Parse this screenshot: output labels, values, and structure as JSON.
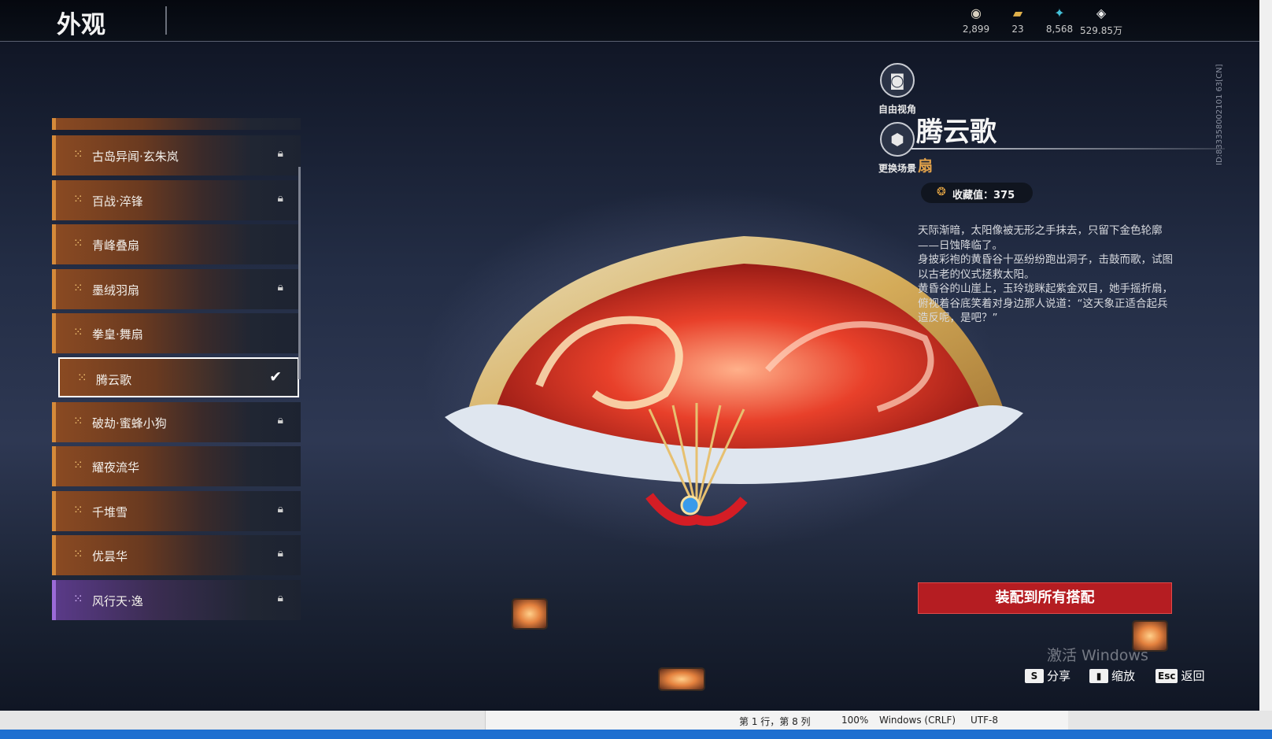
{
  "header": {
    "title": "外观"
  },
  "currencies": [
    {
      "icon": "coin-stack-icon",
      "glyph": "◉",
      "value": "2,899"
    },
    {
      "icon": "ticket-icon",
      "glyph": "▰",
      "value": "23"
    },
    {
      "icon": "feather-icon",
      "glyph": "✦",
      "value": "8,568"
    },
    {
      "icon": "diamond-icon",
      "glyph": "◈",
      "value": "529.85万"
    }
  ],
  "list": {
    "items": [
      {
        "label": "古岛异闻·玄朱岚",
        "locked": true,
        "selected": false,
        "rarity": "orange"
      },
      {
        "label": "百战·淬锋",
        "locked": true,
        "selected": false,
        "rarity": "orange"
      },
      {
        "label": "青峰叠扇",
        "locked": false,
        "selected": false,
        "rarity": "orange"
      },
      {
        "label": "墨绒羽扇",
        "locked": true,
        "selected": false,
        "rarity": "orange"
      },
      {
        "label": "拳皇·舞扇",
        "locked": false,
        "selected": false,
        "rarity": "orange"
      },
      {
        "label": "腾云歌",
        "locked": false,
        "selected": true,
        "rarity": "orange"
      },
      {
        "label": "破劫·蜜蜂小狗",
        "locked": true,
        "selected": false,
        "rarity": "orange"
      },
      {
        "label": "耀夜流华",
        "locked": false,
        "selected": false,
        "rarity": "orange"
      },
      {
        "label": "千堆雪",
        "locked": true,
        "selected": false,
        "rarity": "orange"
      },
      {
        "label": "优昙华",
        "locked": true,
        "selected": false,
        "rarity": "orange"
      },
      {
        "label": "风行天·逸",
        "locked": true,
        "selected": false,
        "rarity": "purple"
      }
    ]
  },
  "side_buttons": {
    "free_view": "自由视角",
    "change_scene": "更换场景"
  },
  "detail": {
    "name": "腾云歌",
    "type": "扇",
    "collect": "收藏值：375",
    "description": "天际渐暗，太阳像被无形之手抹去，只留下金色轮廓——日蚀降临了。\n身披彩袍的黄昏谷十巫纷纷跑出洞子，击鼓而歌，试图以古老的仪式拯救太阳。\n黄昏谷的山崖上，玉玲珑眯起紫金双目，她手摇折扇，俯视着谷底笑着对身边那人说道：“这天象正适合起兵造反呢，是吧？”",
    "equip_button": "装配到所有搭配"
  },
  "uid": "ID:833358002101 63[CN]",
  "watermark": "激活 Windows",
  "hints": [
    {
      "key": "S",
      "label": "分享"
    },
    {
      "key": "▮",
      "label": "缩放"
    },
    {
      "key": "Esc",
      "label": "返回"
    }
  ],
  "statusbar": {
    "position": "第 1 行，第 8 列",
    "zoom": "100%",
    "line_ending": "Windows (CRLF)",
    "encoding": "UTF-8"
  },
  "colors": {
    "accent_red": "#b51d22",
    "rarity_orange": "#d58a3a",
    "rarity_purple": "#9b6ad8",
    "type_gold": "#e2a24a"
  }
}
